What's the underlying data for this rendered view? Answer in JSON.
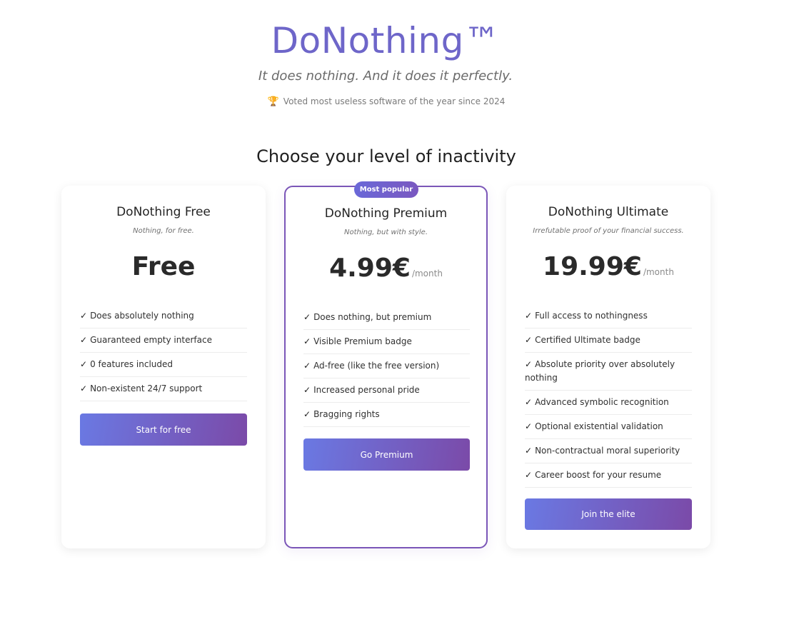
{
  "header": {
    "brand": "DoNothing™",
    "tagline": "It does nothing. And it does it perfectly.",
    "award_icon": "trophy-icon",
    "award_text": "Voted most useless software of the year since 2024"
  },
  "section_title": "Choose your level of inactivity",
  "colors": {
    "brand": "#6e66c9",
    "accent_start": "#6a79e3",
    "accent_end": "#7b4aa8",
    "featured_border": "#7b56b8"
  },
  "plans": [
    {
      "name": "DoNothing Free",
      "subtitle": "Nothing, for free.",
      "price": "Free",
      "period": "",
      "features": [
        "Does absolutely nothing",
        "Guaranteed empty interface",
        "0 features included",
        "Non-existent 24/7 support"
      ],
      "cta": "Start for free"
    },
    {
      "name": "DoNothing Premium",
      "badge": "Most popular",
      "subtitle": "Nothing, but with style.",
      "price": "4.99€",
      "period": "/month",
      "features": [
        "Does nothing, but premium",
        "Visible Premium badge",
        "Ad-free (like the free version)",
        "Increased personal pride",
        "Bragging rights"
      ],
      "cta": "Go Premium"
    },
    {
      "name": "DoNothing Ultimate",
      "subtitle": "Irrefutable proof of your financial success.",
      "price": "19.99€",
      "period": "/month",
      "features": [
        "Full access to nothingness",
        "Certified Ultimate badge",
        "Absolute priority over absolutely nothing",
        "Advanced symbolic recognition",
        "Optional existential validation",
        "Non-contractual moral superiority",
        "Career boost for your resume"
      ],
      "cta": "Join the elite"
    }
  ]
}
